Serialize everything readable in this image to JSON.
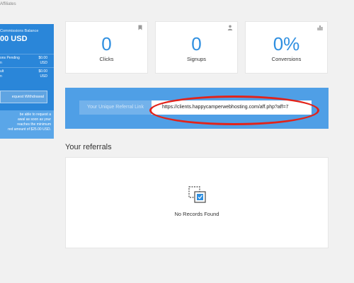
{
  "breadcrumb": "Affiliates",
  "sidebar": {
    "balance_title": "Commissions Balance",
    "balance_amount": "00 USD",
    "rows": [
      {
        "label": "ons Pending",
        "value": "$0.00"
      },
      {
        "label": "n",
        "value": "USD"
      },
      {
        "label": "ult",
        "value": "$0.00"
      },
      {
        "label": "n",
        "value": "USD"
      }
    ],
    "withdraw_label": "equest Withdrawal",
    "notice_lines": [
      "be able to request a",
      "awal as soon as your",
      "reaches the minimum",
      "red amount of $25.00 USD."
    ]
  },
  "stats": [
    {
      "value": "0",
      "label": "Clicks",
      "icon": "bookmark-icon"
    },
    {
      "value": "0",
      "label": "Signups",
      "icon": "user-icon"
    },
    {
      "value": "0%",
      "label": "Conversions",
      "icon": "bar-chart-icon"
    }
  ],
  "referral": {
    "label": "Your Unique Referral Link",
    "link": "https://clients.happycamperwebhosting.com/aff.php?aff=7"
  },
  "referrals_heading": "Your referrals",
  "empty_text": "No Records Found",
  "colors": {
    "accent": "#2a86d9",
    "bar": "#4f9fe6",
    "highlight": "#e2231a"
  }
}
